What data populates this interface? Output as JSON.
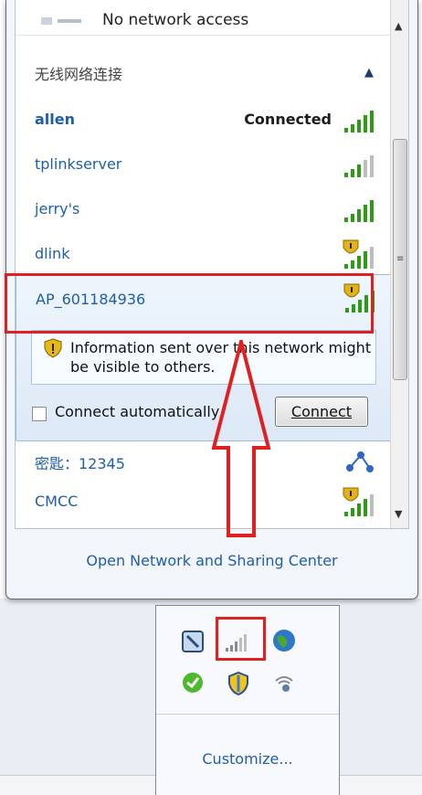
{
  "flyout": {
    "top_status": "No network access",
    "section_title": "无线网络连接",
    "networks": [
      {
        "name": "allen",
        "status": "Connected",
        "secured": false,
        "signal_bars": 5
      },
      {
        "name": "tplinkserver",
        "status": "",
        "secured": false,
        "signal_bars": 3
      },
      {
        "name": "jerry's",
        "status": "",
        "secured": false,
        "signal_bars": 5
      },
      {
        "name": "dlink",
        "status": "",
        "secured": true,
        "signal_bars": 4
      },
      {
        "name": "AP_601184936",
        "status": "",
        "secured": true,
        "signal_bars": 5
      },
      {
        "name": "密匙：12345",
        "status": "",
        "secured": false,
        "signal_bars": 0
      },
      {
        "name": "CMCC",
        "status": "",
        "secured": true,
        "signal_bars": 4
      }
    ],
    "expanded": {
      "info_text": "Information sent over this network might be visible to others.",
      "auto_connect_label": "Connect automatically",
      "connect_button": "Connect"
    },
    "footer_link": "Open Network and Sharing Center"
  },
  "tray": {
    "customize_link": "Customize..."
  },
  "colors": {
    "link_blue": "#1f5fa8",
    "highlight_red": "#e02020",
    "signal_green": "#2e9b14"
  }
}
